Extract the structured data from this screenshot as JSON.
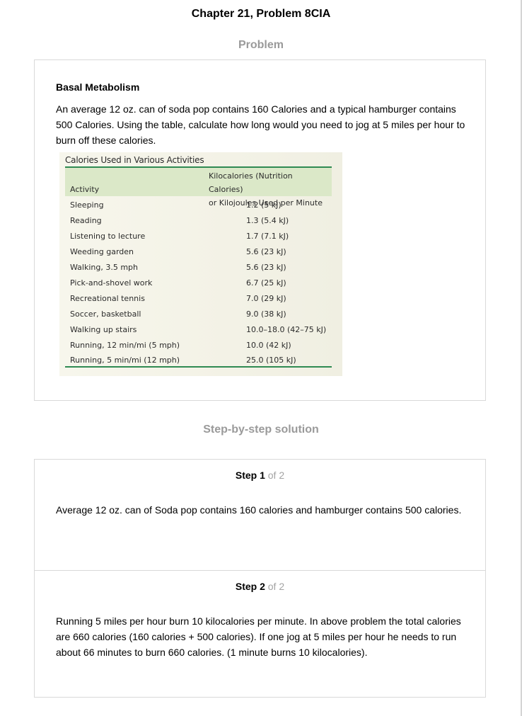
{
  "page_title": "Chapter 21, Problem 8CIA",
  "problem_section_label": "Problem",
  "problem": {
    "heading": "Basal Metabolism",
    "text": "An average 12 oz. can of soda pop contains 160 Calories and a typical hamburger contains 500 Calories. Using the table, calculate how long would you need to jog at 5 miles per hour to burn off these calories.",
    "table": {
      "caption": "Calories Used in Various Activities",
      "col_activity": "Activity",
      "col_kcal_line1": "Kilocalories (Nutrition Calories)",
      "col_kcal_line2": "or Kilojoules Used per Minute",
      "rows": [
        {
          "activity": "Sleeping",
          "value": "1.2 (5 kJ)"
        },
        {
          "activity": "Reading",
          "value": "1.3 (5.4 kJ)"
        },
        {
          "activity": "Listening to lecture",
          "value": "1.7 (7.1 kJ)"
        },
        {
          "activity": "Weeding garden",
          "value": "5.6 (23 kJ)"
        },
        {
          "activity": "Walking, 3.5 mph",
          "value": "5.6 (23 kJ)"
        },
        {
          "activity": "Pick-and-shovel work",
          "value": "6.7 (25 kJ)"
        },
        {
          "activity": "Recreational tennis",
          "value": "7.0 (29 kJ)"
        },
        {
          "activity": "Soccer, basketball",
          "value": "9.0 (38 kJ)"
        },
        {
          "activity": "Walking up stairs",
          "value": "10.0–18.0 (42–75 kJ)"
        },
        {
          "activity": "Running, 12 min/mi (5 mph)",
          "value": "10.0 (42 kJ)"
        },
        {
          "activity": "Running, 5 min/mi (12 mph)",
          "value": "25.0 (105 kJ)"
        }
      ]
    }
  },
  "solution_section_label": "Step-by-step solution",
  "steps": [
    {
      "step_word": "Step 1",
      "of_text": " of 2",
      "text": "Average 12 oz. can of Soda pop contains 160 calories and hamburger contains 500 calories."
    },
    {
      "step_word": "Step 2",
      "of_text": " of 2",
      "text": "Running 5 miles per hour burn 10 kilocalories per minute. In above problem the total calories are 660 calories (160 calories + 500 calories). If one jog at 5 miles per hour he needs to run about 66 minutes to burn 660 calories. (1 minute burns 10 kilocalories)."
    }
  ]
}
